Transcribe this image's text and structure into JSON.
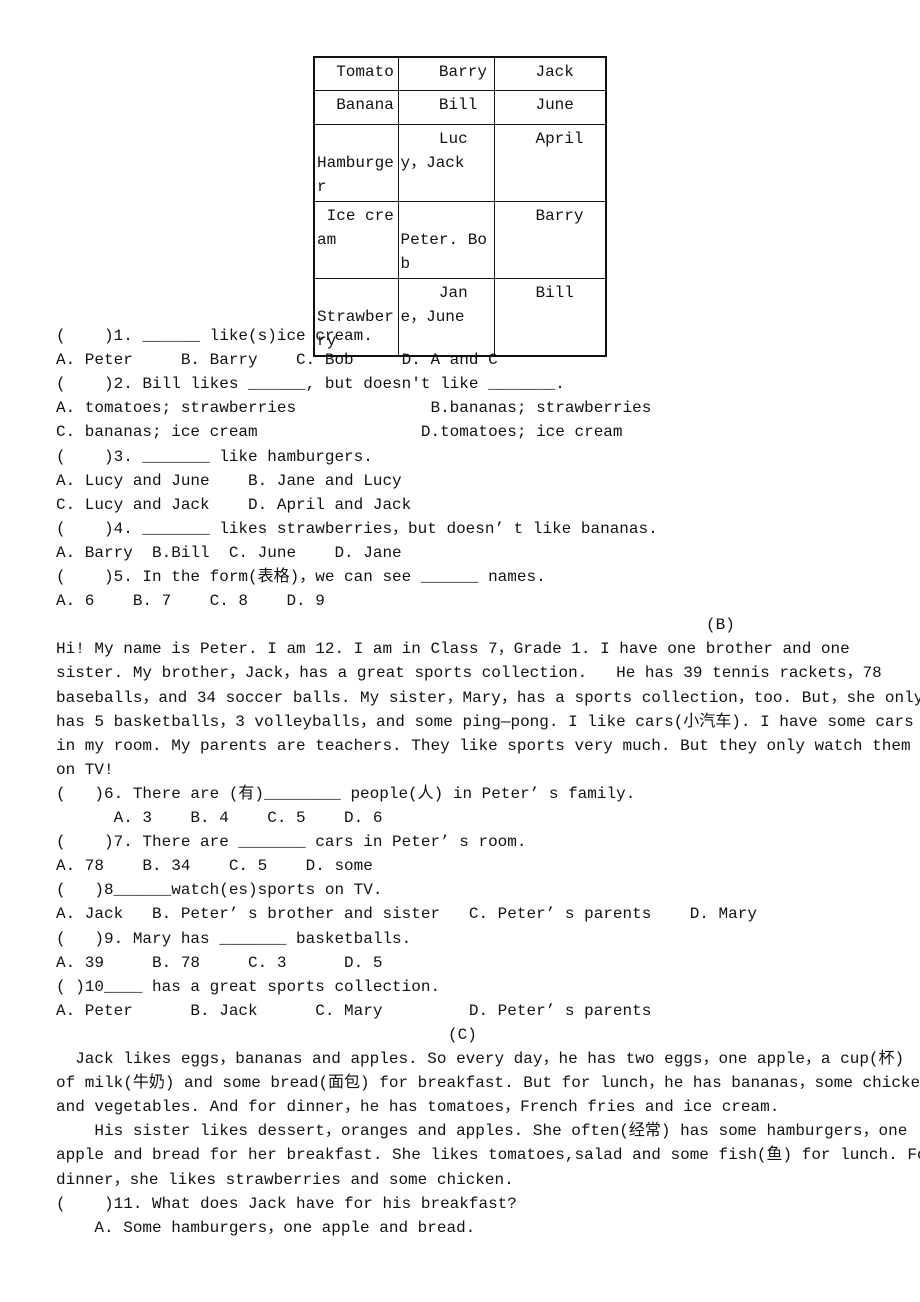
{
  "table": {
    "rows": [
      [
        "  Tomato",
        "    Barry",
        "    Jack"
      ],
      [
        "  Banana",
        "    Bill",
        "    June"
      ],
      [
        "\nHamburger",
        "    Lucy，Jack",
        "    April"
      ],
      [
        " Ice cream",
        "\nPeter. Bob",
        "    Barry"
      ],
      [
        "\nStrawberry",
        "    Jane，June",
        "    Bill"
      ]
    ]
  },
  "lines": [
    "(    )1. ______ like(s)ice cream.",
    "A. Peter     B. Barry    C. Bob     D. A and C",
    "(    )2. Bill likes ______, but doesn't like _______.",
    "A. tomatoes; strawberries              B.bananas; strawberries",
    "C. bananas; ice cream                 D.tomatoes; ice cream",
    "(    )3. _______ like hamburgers.",
    "A. Lucy and June    B. Jane and Lucy",
    "C. Lucy and Jack    D. April and Jack",
    "(    )4. _______ likes strawberries，but doesn’ t like bananas.",
    "A. Barry  B.Bill  C. June    D. Jane",
    "(    )5. In the form(表格)，we can see ______ names.",
    "A. 6    B. 7    C. 8    D. 9",
    "(B)",
    "Hi! My name is Peter. I am 12. I am in Class 7，Grade 1. I have one brother and one",
    "sister. My brother，Jack，has a great sports collection.   He has 39 tennis rackets，78",
    "baseballs，and 34 soccer balls. My sister，Mary，has a sports collection，too. But，she only",
    "has 5 basketballs，3 volleyballs，and some ping—pong. I like cars(小汽车). I have some cars",
    "in my room. My parents are teachers. They like sports very much. But they only watch them",
    "on TV!",
    "(   )6. There are (有)________ people(人) in Peter’ s family.",
    "      A. 3    B. 4    C. 5    D. 6",
    "(    )7. There are _______ cars in Peter’ s room.",
    "A. 78    B. 34    C. 5    D. some",
    "(   )8______watch(es)sports on TV.",
    "A. Jack   B. Peter’ s brother and sister   C. Peter’ s parents    D. Mary",
    "(   )9. Mary has _______ basketballs.",
    "A. 39     B. 78     C. 3      D. 5",
    "( )10____ has a great sports collection.",
    "A. Peter      B. Jack      C. Mary         D. Peter’ s parents",
    "(C)",
    "  Jack likes eggs，bananas and apples. So every day，he has two eggs，one apple，a cup(杯)",
    "of milk(牛奶) and some bread(面包) for breakfast. But for lunch，he has bananas，some chicken",
    "and vegetables. And for dinner，he has tomatoes，French fries and ice cream.",
    "    His sister likes dessert，oranges and apples. She often(经常) has some hamburgers，one",
    "apple and bread for her breakfast. She likes tomatoes,salad and some fish(鱼) for lunch. For",
    "dinner，she likes strawberries and some chicken.",
    "(    )11. What does Jack have for his breakfast?",
    "    A. Some hamburgers，one apple and bread."
  ]
}
